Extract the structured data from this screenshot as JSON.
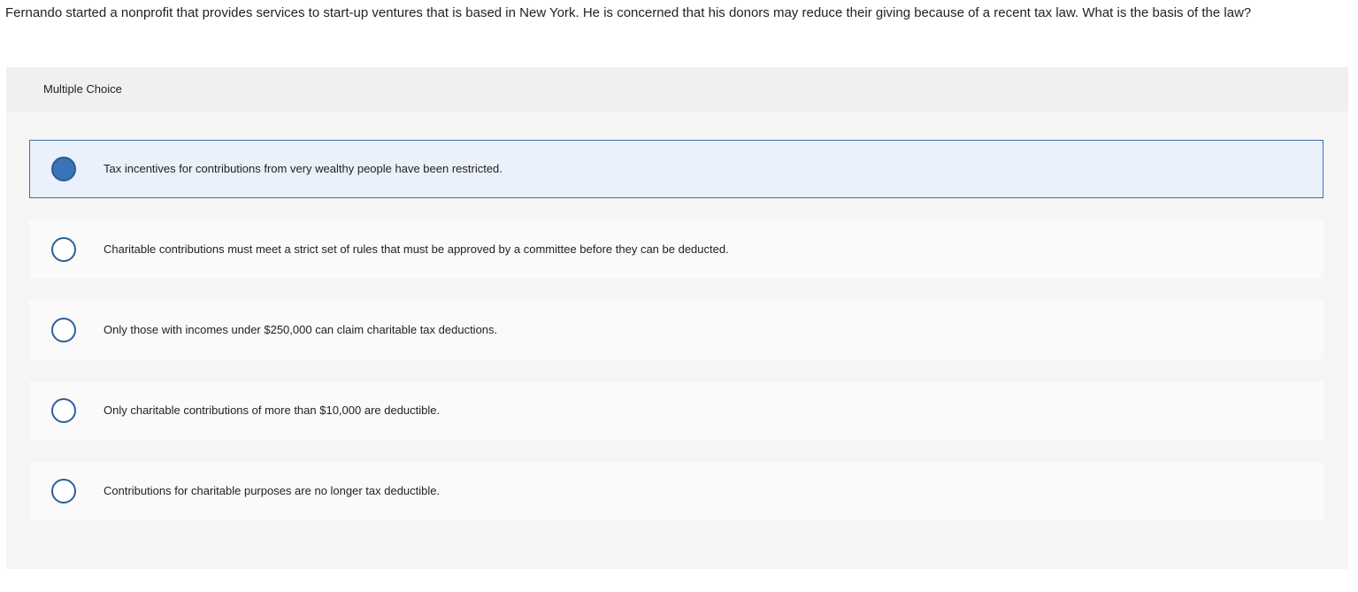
{
  "question": {
    "text": "Fernando started a nonprofit that provides services to start-up ventures that is based in New York. He is concerned that his donors may reduce their giving because of a recent tax law. What is the basis of the law?"
  },
  "answer_panel": {
    "header": "Multiple Choice",
    "options": [
      {
        "label": "Tax incentives for contributions from very wealthy people have been restricted.",
        "selected": true
      },
      {
        "label": "Charitable contributions must meet a strict set of rules that must be approved by a committee before they can be deducted.",
        "selected": false
      },
      {
        "label": "Only those with incomes under $250,000 can claim charitable tax deductions.",
        "selected": false
      },
      {
        "label": "Only charitable contributions of more than $10,000 are deductible.",
        "selected": false
      },
      {
        "label": "Contributions for charitable purposes are no longer tax deductible.",
        "selected": false
      }
    ]
  },
  "colors": {
    "selected_fill": "#3b73b9",
    "selected_background": "#eaf1fa",
    "radio_border": "#2f5f9a"
  }
}
